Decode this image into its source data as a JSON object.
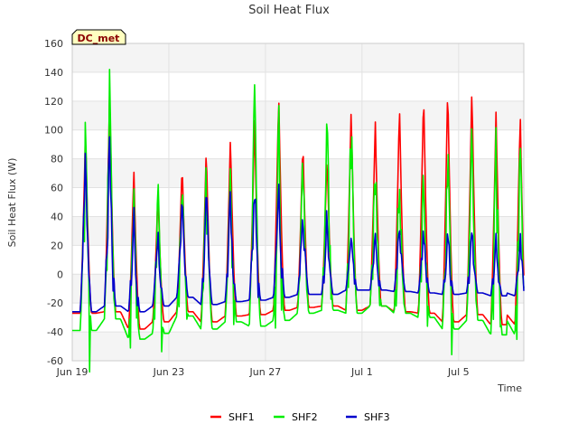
{
  "chart_data": {
    "type": "line",
    "title": "Soil Heat Flux",
    "xlabel": "Time",
    "ylabel": "Soil Heat Flux (W)",
    "badge": "DC_met",
    "x_start": "2024-06-19",
    "x_end": "2024-07-07",
    "ylim": [
      -60,
      160
    ],
    "yticks": [
      -60,
      -40,
      -20,
      0,
      20,
      40,
      60,
      80,
      100,
      120,
      140,
      160
    ],
    "xticks": [
      {
        "date": "2024-06-19",
        "label": "Jun 19"
      },
      {
        "date": "2024-06-23",
        "label": "Jun 23"
      },
      {
        "date": "2024-06-27",
        "label": "Jun 27"
      },
      {
        "date": "2024-07-01",
        "label": "Jul 1"
      },
      {
        "date": "2024-07-05",
        "label": "Jul 5"
      }
    ],
    "grid": true,
    "legend_position": "bottom",
    "series": [
      {
        "name": "SHF1",
        "color": "#ff0000",
        "x": [
          "2024-06-19",
          "2024-06-20",
          "2024-06-21",
          "2024-06-22",
          "2024-06-23",
          "2024-06-24",
          "2024-06-25",
          "2024-06-26",
          "2024-06-27",
          "2024-06-28",
          "2024-06-29",
          "2024-06-30",
          "2024-07-01",
          "2024-07-02",
          "2024-07-03",
          "2024-07-04",
          "2024-07-05",
          "2024-07-06"
        ],
        "min": [
          -27,
          -26,
          -38,
          -33,
          -26,
          -33,
          -29,
          -28,
          -25,
          -23,
          -22,
          -25,
          -22,
          -26,
          -27,
          -33,
          -28,
          -35
        ],
        "max": [
          100,
          127,
          73,
          57,
          78,
          89,
          95,
          108,
          127,
          93,
          84,
          116,
          106,
          118,
          128,
          133,
          130,
          113
        ]
      },
      {
        "name": "SHF2",
        "color": "#00ee00",
        "x": [
          "2024-06-19",
          "2024-06-20",
          "2024-06-21",
          "2024-06-22",
          "2024-06-23",
          "2024-06-24",
          "2024-06-25",
          "2024-06-26",
          "2024-06-27",
          "2024-06-28",
          "2024-06-29",
          "2024-06-30",
          "2024-07-01",
          "2024-07-02",
          "2024-07-03",
          "2024-07-04",
          "2024-07-05",
          "2024-07-06"
        ],
        "min": [
          -39,
          -31,
          -45,
          -41,
          -29,
          -38,
          -33,
          -36,
          -32,
          -27,
          -25,
          -27,
          -22,
          -27,
          -30,
          -38,
          -32,
          -42
        ],
        "max": [
          119,
          146,
          68,
          73,
          78,
          85,
          78,
          145,
          131,
          91,
          126,
          125,
          94,
          90,
          90,
          107,
          108,
          110
        ]
      },
      {
        "name": "SHF3",
        "color": "#0000cc",
        "x": [
          "2024-06-19",
          "2024-06-20",
          "2024-06-21",
          "2024-06-22",
          "2024-06-23",
          "2024-06-24",
          "2024-06-25",
          "2024-06-26",
          "2024-06-27",
          "2024-06-28",
          "2024-06-29",
          "2024-06-30",
          "2024-07-01",
          "2024-07-02",
          "2024-07-03",
          "2024-07-04",
          "2024-07-05",
          "2024-07-06"
        ],
        "min": [
          -26,
          -22,
          -26,
          -22,
          -16,
          -21,
          -19,
          -18,
          -16,
          -14,
          -14,
          -11,
          -11,
          -12,
          -13,
          -14,
          -13,
          -15
        ],
        "max": [
          99,
          112,
          55,
          35,
          58,
          68,
          64,
          75,
          74,
          52,
          50,
          37,
          38,
          42,
          38,
          38,
          37,
          32
        ]
      }
    ]
  }
}
